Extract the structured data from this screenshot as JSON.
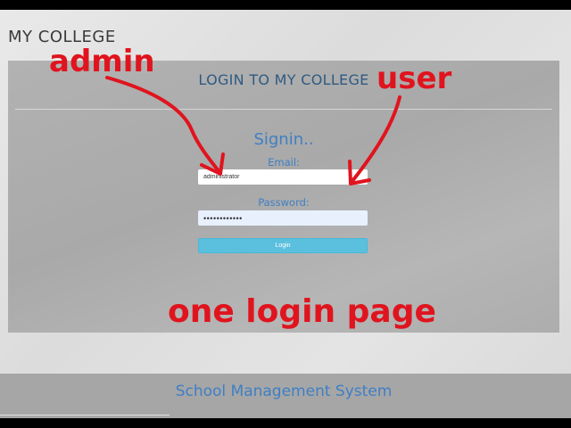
{
  "brand": "MY COLLEGE",
  "login_panel": {
    "title": "LOGIN TO MY COLLEGE",
    "heading": "Signin..",
    "email_label": "Email:",
    "email_value": "administrator",
    "password_label": "Password:",
    "password_value": "••••••••••••",
    "login_button": "Login"
  },
  "footer": {
    "text": "School Management System"
  },
  "annotations": {
    "admin": "admin",
    "user": "user",
    "caption": "one login page",
    "color": "#e0141e"
  }
}
